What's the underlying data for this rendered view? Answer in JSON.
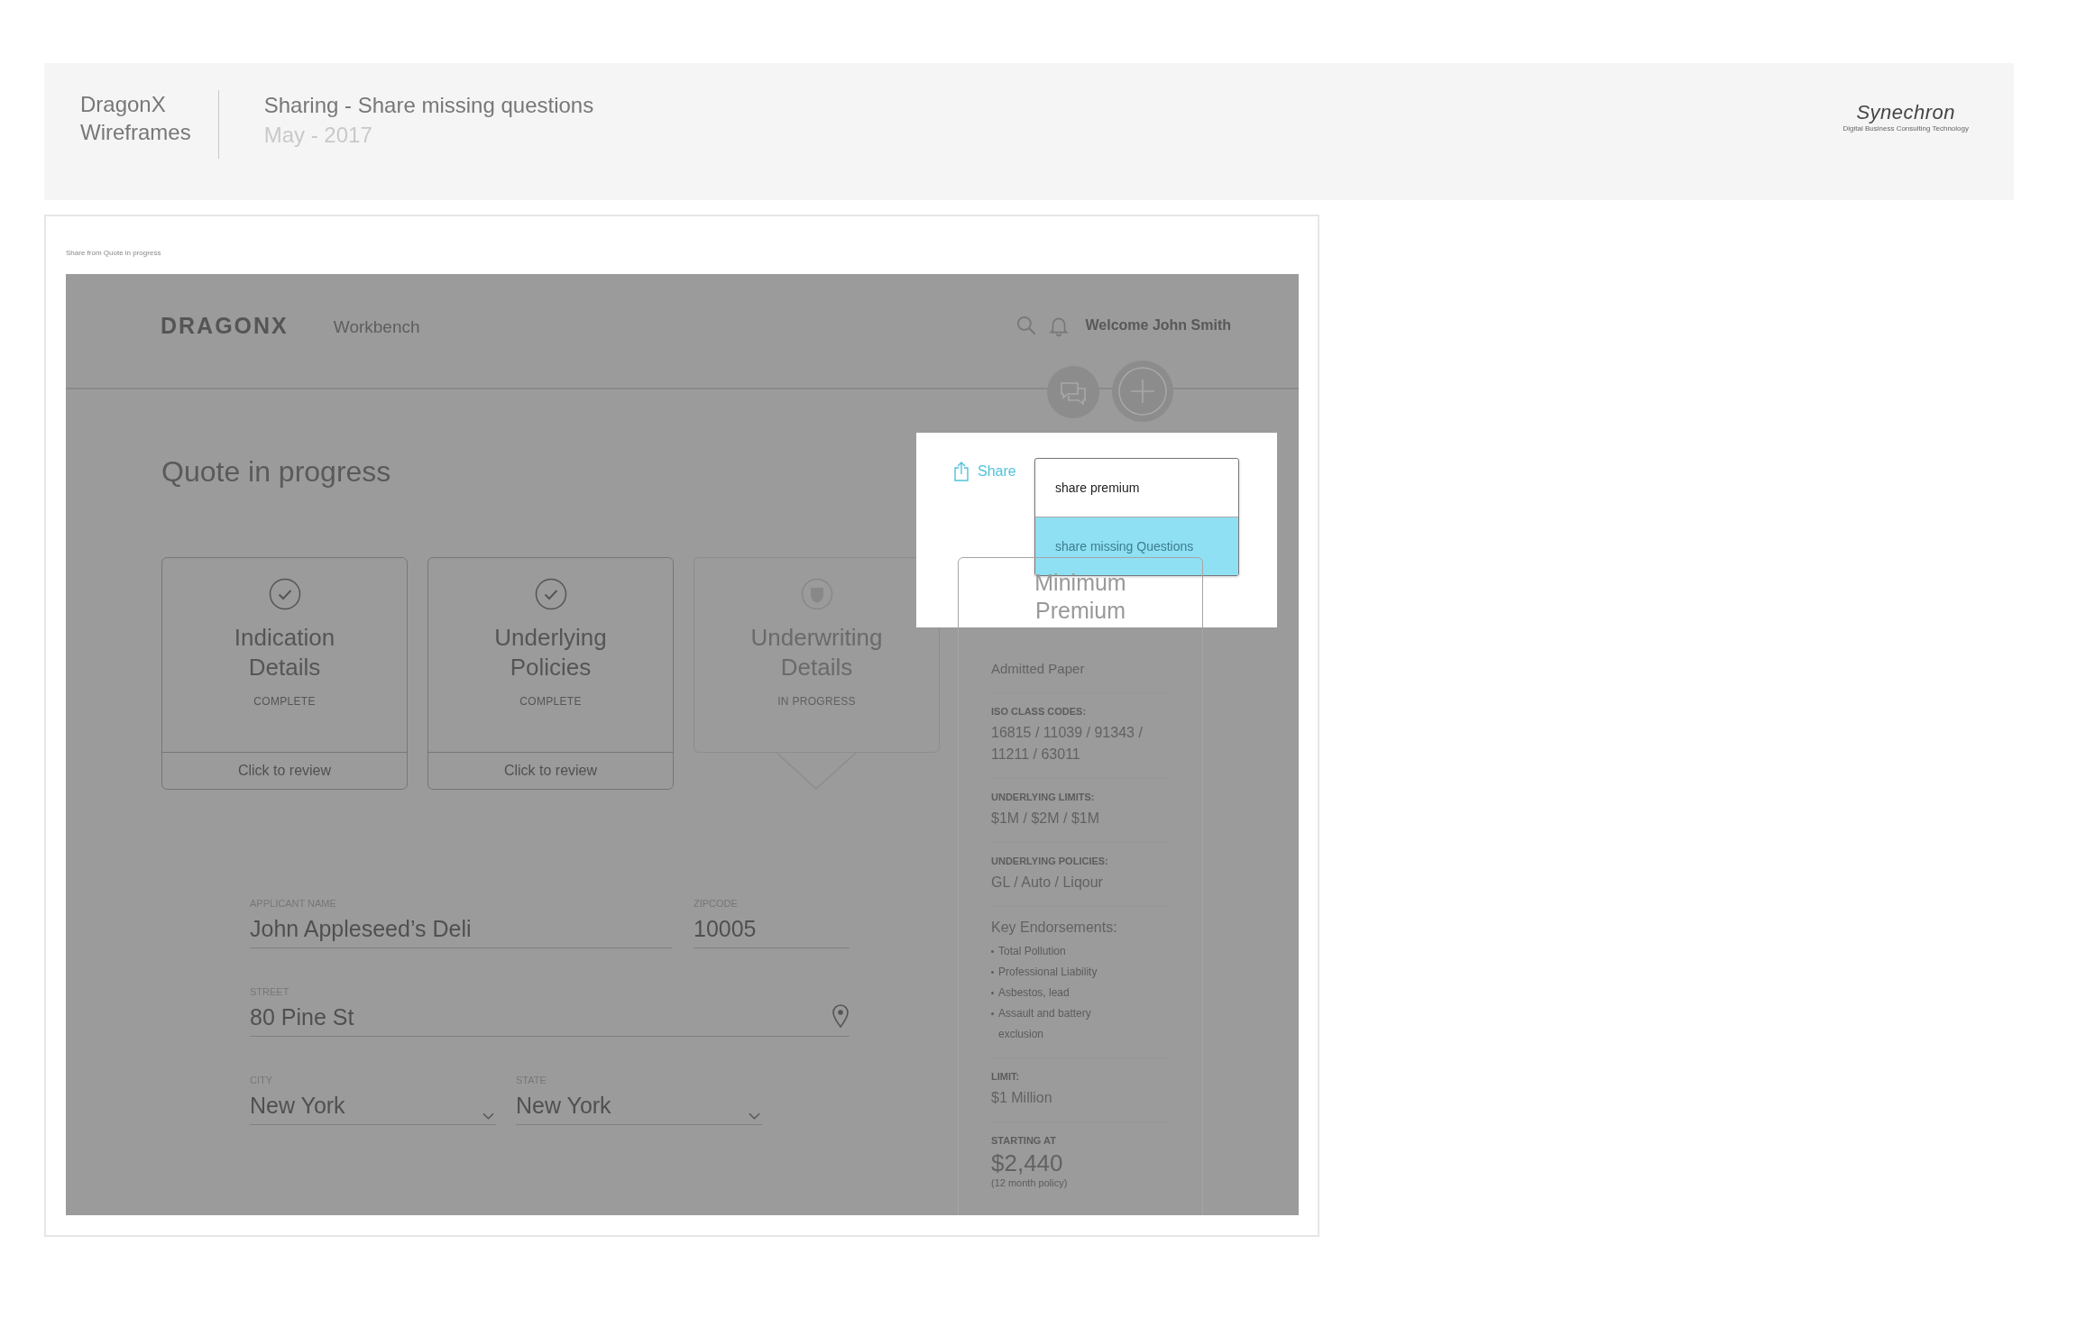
{
  "header": {
    "project": "DragonX",
    "subtitle": "Wireframes",
    "title": "Sharing - Share missing questions",
    "date": "May - 2017",
    "logo": "Synechron",
    "logo_tagline": "Digital  Business Consulting  Technology"
  },
  "frame": {
    "caption": "Share from Quote in progress"
  },
  "app": {
    "brand": "DRAGONX",
    "nav_link": "Workbench",
    "welcome": "Welcome John Smith"
  },
  "page_title": "Quote in progress",
  "steps": [
    {
      "title": "Indication Details",
      "status": "COMPLETE",
      "action": "Click to review",
      "kind": "complete"
    },
    {
      "title": "Underlying Policies",
      "status": "COMPLETE",
      "action": "Click to review",
      "kind": "complete"
    },
    {
      "title": "Underwriting Details",
      "status": "IN PROGRESS",
      "kind": "current"
    }
  ],
  "share": {
    "label": "Share",
    "options": [
      {
        "label": "share premium",
        "selected": false
      },
      {
        "label": "share missing Questions",
        "selected": true
      }
    ]
  },
  "summary": {
    "title": "Minimum Premium",
    "paper": "Admitted Paper",
    "sections": [
      {
        "label": "ISO CLASS CODES:",
        "value": "16815 / 11039 / 91343 / 11211 / 63011"
      },
      {
        "label": "UNDERLYING LIMITS:",
        "value": "$1M / $2M / $1M"
      },
      {
        "label": "UNDERLYING POLICIES:",
        "value": "GL / Auto / Liqour"
      }
    ],
    "endorsements_title": "Key Endorsements:",
    "endorsements": [
      "Total Pollution",
      "Professional Liability",
      "Asbestos, lead",
      "Assault and battery exclusion"
    ],
    "limit": {
      "label": "LIMIT:",
      "value": "$1 Million"
    },
    "starting": {
      "label": "STARTING AT",
      "value": "$2,440",
      "note": "(12 month policy)"
    }
  },
  "form": {
    "rows": [
      [
        {
          "label": "APPLICANT NAME",
          "value": "John Appleseed’s Deli",
          "kind": "text"
        },
        {
          "label": "ZIPCODE",
          "value": "10005",
          "kind": "text"
        }
      ],
      [
        {
          "label": "STREET",
          "value": "80 Pine St",
          "kind": "location"
        }
      ],
      [
        {
          "label": "CITY",
          "value": "New York",
          "kind": "select"
        },
        {
          "label": "STATE",
          "value": "New York",
          "kind": "select"
        }
      ]
    ]
  }
}
